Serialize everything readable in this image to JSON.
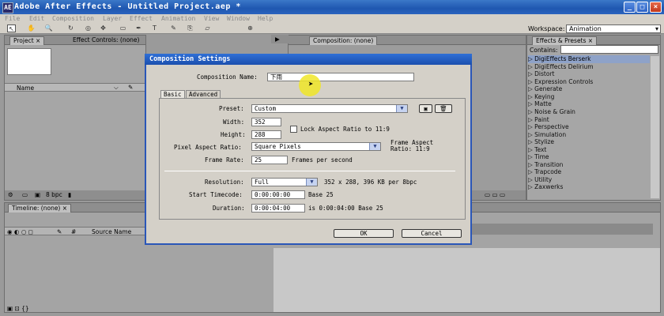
{
  "window": {
    "title": "Adobe After Effects - Untitled Project.aep *",
    "app_icon": "AE",
    "controls": [
      "_",
      "□",
      "×"
    ]
  },
  "menu": [
    "File",
    "Edit",
    "Composition",
    "Layer",
    "Effect",
    "Animation",
    "View",
    "Window",
    "Help"
  ],
  "toolbar": {
    "tools": [
      "selection-arrow-icon",
      "hand-icon",
      "zoom-icon",
      "rotate-icon",
      "orbit-camera-icon",
      "track-xy-icon",
      "track-z-icon",
      "rectangle-mask-icon",
      "pen-icon",
      "text-icon",
      "brush-icon",
      "clone-stamp-icon",
      "eraser-icon",
      "axis-icon"
    ],
    "workspace_label": "Workspace:",
    "workspace_value": "Animation"
  },
  "project_panel": {
    "tab_project": "Project",
    "tab_effect_controls": "Effect Controls: (none)",
    "column_name": "Name",
    "bpc_label": "8 bpc"
  },
  "composition_panel": {
    "tab": "Composition: (none)"
  },
  "effects_panel": {
    "tab": "Effects & Presets",
    "contains_label": "Contains:",
    "items": [
      "DigiEffects Berserk",
      "DigiEffects Delirium",
      "Distort",
      "Expression Controls",
      "Generate",
      "Keying",
      "Matte",
      "Noise & Grain",
      "Paint",
      "Perspective",
      "Simulation",
      "Stylize",
      "Text",
      "Time",
      "Transition",
      "Trapcode",
      "Utility",
      "Zaxwerks"
    ]
  },
  "timeline_panel": {
    "tab": "Timeline: (none)",
    "source_name": "Source Name"
  },
  "dialog": {
    "title": "Composition Settings",
    "comp_name_label": "Composition Name:",
    "comp_name_value": "下雨",
    "tab_basic": "Basic",
    "tab_advanced": "Advanced",
    "preset_label": "Preset:",
    "preset_value": "Custom",
    "width_label": "Width:",
    "width_value": "352",
    "height_label": "Height:",
    "height_value": "288",
    "lock_aspect_label": "Lock Aspect Ratio to 11:9",
    "pixel_aspect_label": "Pixel Aspect Ratio:",
    "pixel_aspect_value": "Square Pixels",
    "frame_aspect_label": "Frame Aspect",
    "frame_aspect_ratio": "Ratio: 11:9",
    "frame_rate_label": "Frame Rate:",
    "frame_rate_value": "25",
    "frame_rate_unit": "Frames per second",
    "resolution_label": "Resolution:",
    "resolution_value": "Full",
    "resolution_info": "352 x 288, 396 KB per 8bpc",
    "start_tc_label": "Start Timecode:",
    "start_tc_value": "0:00:00:00",
    "start_tc_base": "Base 25",
    "duration_label": "Duration:",
    "duration_value": "0:00:04:00",
    "duration_info": "is 0:00:04:00  Base 25",
    "ok_label": "OK",
    "cancel_label": "Cancel"
  }
}
